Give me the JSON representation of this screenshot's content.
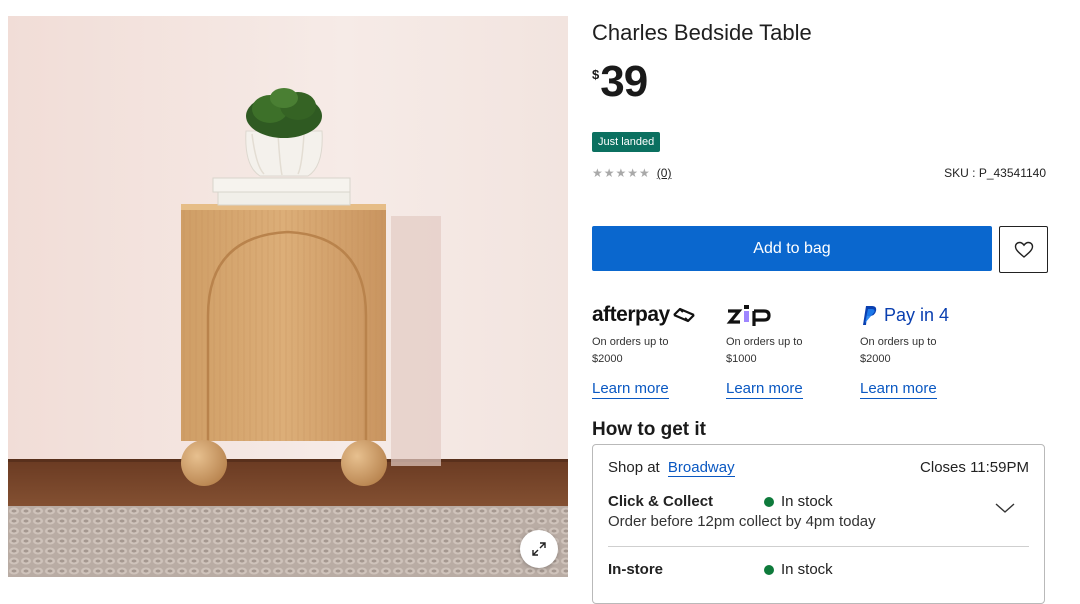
{
  "product": {
    "title": "Charles Bedside Table",
    "price_currency": "$",
    "price_amount": "39",
    "badge": "Just landed",
    "rating_stars": "★★★★★",
    "review_count": "(0)",
    "sku": "SKU : P_43541140"
  },
  "actions": {
    "add_to_bag": "Add to bag"
  },
  "icons": {
    "wishlist": "heart-icon",
    "expand": "expand-icon",
    "afterpay": "afterpay-logo",
    "zip": "zip-logo",
    "paypal": "paypal-icon"
  },
  "payments": [
    {
      "name": "afterpay",
      "logo_text": "afterpay",
      "desc": "On orders up to $2000",
      "link": "Learn more"
    },
    {
      "name": "zip",
      "logo_text": "zip",
      "desc": "On orders up to $1000",
      "link": "Learn more"
    },
    {
      "name": "paypal",
      "logo_text": "Pay in 4",
      "desc": "On orders up to $2000",
      "link": "Learn more"
    }
  ],
  "fulfilment": {
    "heading": "How to get it",
    "shop_at_label": "Shop at",
    "store_name": "Broadway",
    "closes": "Closes 11:59PM",
    "click_collect": {
      "title": "Click & Collect",
      "status": "In stock",
      "note": "Order before 12pm collect by 4pm today"
    },
    "in_store": {
      "title": "In-store",
      "status": "In stock"
    }
  },
  "colors": {
    "primary_button": "#0a67ce",
    "badge": "#0b7060",
    "link": "#0a58c2",
    "in_stock": "#0e7a3b"
  }
}
